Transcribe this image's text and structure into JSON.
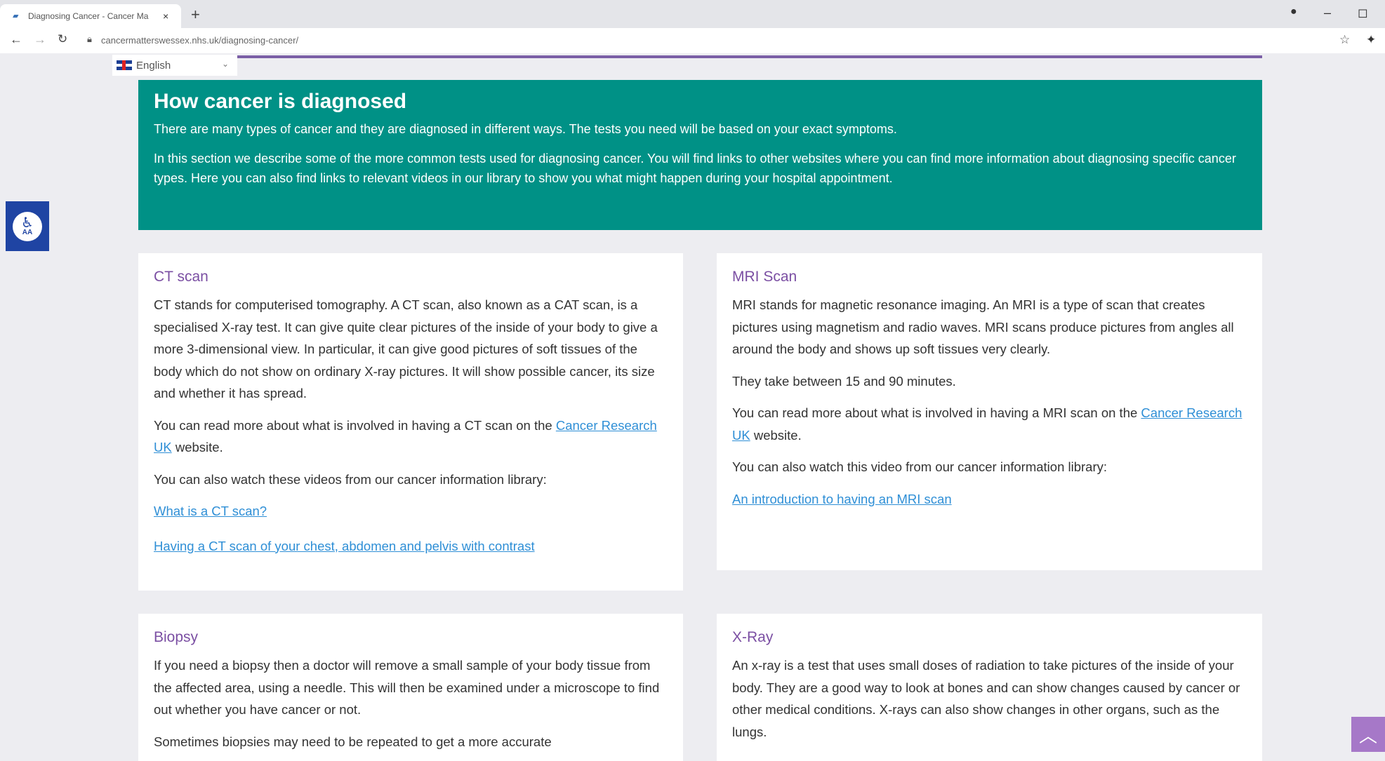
{
  "browser": {
    "tab_title": "Diagnosing Cancer - Cancer Ma",
    "tab_close": "×",
    "new_tab": "+",
    "url": "cancermatterswessex.nhs.uk/diagnosing-cancer/",
    "lock_icon": "lock-icon",
    "window_controls": {
      "minimize": "–",
      "restore": "◻"
    }
  },
  "language": {
    "label": "English",
    "chevron": "⌄"
  },
  "hero": {
    "title": "How cancer is diagnosed",
    "para1": "There are many types of cancer and they are diagnosed in different ways. The tests you need will be based on your exact symptoms.",
    "para2": "In this section we describe some of the more common tests used for diagnosing cancer. You will find links to other websites where you can find more information about diagnosing specific cancer types. Here you can also find links to relevant videos in our library to show you what might happen during your hospital appointment."
  },
  "accessibility": {
    "small_label": "AA"
  },
  "cards": {
    "ct": {
      "title": "CT scan",
      "p1": "CT stands for computerised tomography. A CT scan, also known as a CAT scan, is a specialised X-ray test. It can give quite clear pictures of the inside of your body to give a more 3-dimensional view. In particular, it can give good pictures of soft tissues of the body which do not show on ordinary X-ray pictures. It will show possible cancer, its size and whether it has spread.",
      "p2_before": "You can read more about what is involved in having a CT scan on the ",
      "p2_link": "Cancer Research UK",
      "p2_after": " website.",
      "p3": "You can also watch these videos from our cancer information library:",
      "link1": "What is a CT scan?",
      "link2": "Having a CT scan of your chest, abdomen and pelvis with contrast"
    },
    "mri": {
      "title": "MRI Scan",
      "p1": "MRI stands for magnetic resonance imaging. An MRI is a type of scan that creates pictures using magnetism and radio waves. MRI scans produce pictures from angles all around the body and shows up soft tissues very clearly.",
      "p2": "They take between 15 and 90 minutes.",
      "p3_before": "You can read more about what is involved in having a MRI scan on the ",
      "p3_link": "Cancer Research UK",
      "p3_after": " website.",
      "p4": "You can also watch this video from our cancer information library:",
      "link1": "An introduction to having an MRI scan"
    },
    "biopsy": {
      "title": "Biopsy",
      "p1": "If you need a biopsy then a doctor will remove a small sample of your body tissue from the affected area, using a needle. This will then be examined under a microscope to find out whether you have cancer or not.",
      "p2": "Sometimes biopsies may need to be repeated to get a more accurate"
    },
    "xray": {
      "title": "X-Ray",
      "p1": "An x-ray is a test that uses small doses of radiation to take pictures of the inside of your body. They are a good way to look at bones and can show changes caused by cancer or other medical conditions. X-rays can also show changes in other organs, such as the lungs."
    }
  },
  "colors": {
    "hero_bg": "#009186",
    "heading_purple": "#7b4fa3",
    "link_blue": "#2f8fd6",
    "page_bg": "#ededf1",
    "a11y_blue": "#1f44a3",
    "to_top_bg": "#a678c8"
  }
}
